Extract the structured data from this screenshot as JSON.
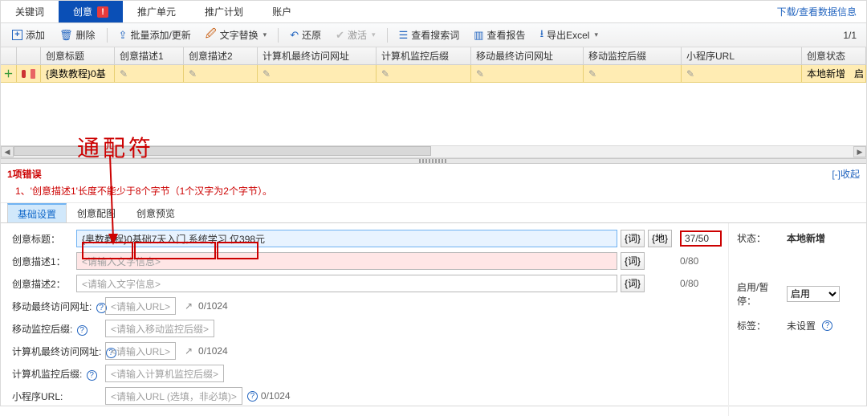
{
  "tabs": {
    "keyword": "关键词",
    "creative": "创意",
    "unit": "推广单元",
    "plan": "推广计划",
    "account": "账户"
  },
  "download_link": "下载/查看数据信息",
  "toolbar": {
    "add": "添加",
    "delete": "删除",
    "batch": "批量添加/更新",
    "replace": "文字替换",
    "restore": "还原",
    "activate": "激活",
    "search": "查看搜索词",
    "report": "查看报告",
    "export": "导出Excel"
  },
  "page": "1/1",
  "columns": {
    "title": "创意标题",
    "desc1": "创意描述1",
    "desc2": "创意描述2",
    "pc_url": "计算机最终访问网址",
    "pc_suffix": "计算机监控后缀",
    "m_url": "移动最终访问网址",
    "m_suffix": "移动监控后缀",
    "mini_url": "小程序URL",
    "status": "创意状态"
  },
  "row": {
    "title": "{奥数教程}0基",
    "status": "本地新增",
    "enable_flag": "启"
  },
  "annotation": "通配符",
  "error": {
    "title": "1项错误",
    "line": "1、'创意描述1'长度不能少于8个字节（1个汉字为2个字节）。",
    "collapse": "[-]收起"
  },
  "subtabs": {
    "basic": "基础设置",
    "image": "创意配图",
    "preview": "创意预览"
  },
  "form": {
    "title_label": "创意标题：",
    "title_value": "{奥数教程}0基础7天入门,系统学习 仅398元",
    "word_btn": "{词}",
    "geo_btn": "{地}",
    "title_count": "37/50",
    "desc1_label": "创意描述1：",
    "desc1_ph": "<请输入文字信息>",
    "desc1_count": "0/80",
    "desc2_label": "创意描述2：",
    "desc2_ph": "<请输入文字信息>",
    "desc2_count": "0/80",
    "m_url_label": "移动最终访问网址:",
    "m_url_ph": "<请输入URL>",
    "m_url_count": "0/1024",
    "m_suffix_label": "移动监控后缀:",
    "m_suffix_ph": "<请输入移动监控后缀>",
    "pc_url_label": "计算机最终访问网址:",
    "pc_url_ph": "<请输入URL>",
    "pc_url_count": "0/1024",
    "pc_suffix_label": "计算机监控后缀:",
    "pc_suffix_ph": "<请输入计算机监控后缀>",
    "mini_label": "小程序URL:",
    "mini_ph": "<请输入URL (选填，非必填)>",
    "mini_count": "0/1024"
  },
  "side": {
    "status_label": "状态：",
    "status_value": "本地新增",
    "enable_label": "启用/暂停：",
    "enable_value": "启用",
    "tag_label": "标签：",
    "tag_value": "未设置"
  }
}
